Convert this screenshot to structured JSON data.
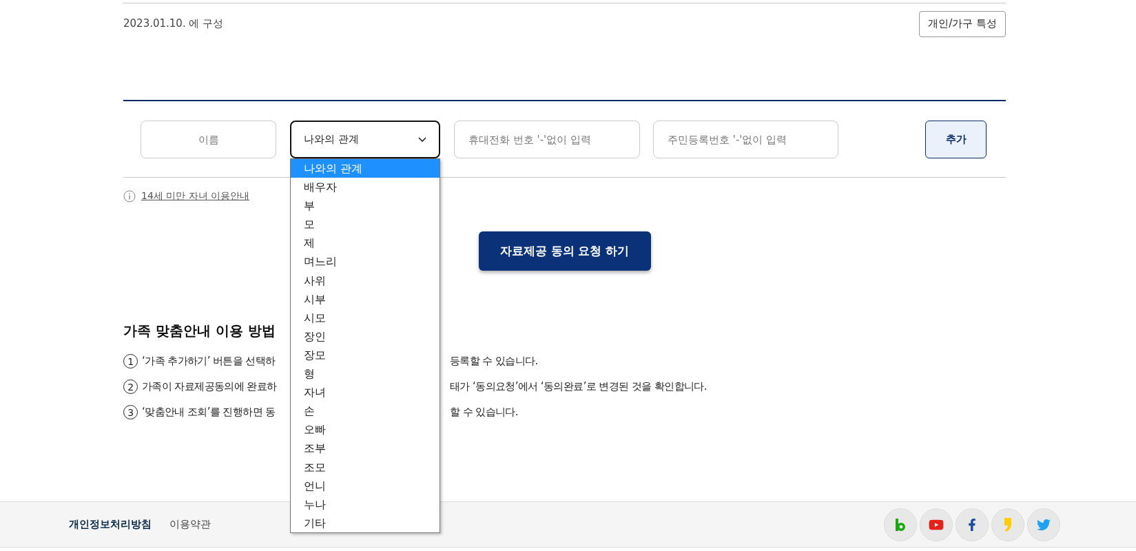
{
  "header": {
    "date": "2023.01.10. 에 구성",
    "profile_button": "개인/가구 특성"
  },
  "form": {
    "name_field": {
      "placeholder": "이름"
    },
    "relation_select": {
      "value": "나와의 관계",
      "expanded": true,
      "options": [
        {
          "label": "나와의 관계",
          "selected": true
        },
        {
          "label": "배우자",
          "selected": false
        },
        {
          "label": "부",
          "selected": false
        },
        {
          "label": "모",
          "selected": false
        },
        {
          "label": "제",
          "selected": false
        },
        {
          "label": "며느리",
          "selected": false
        },
        {
          "label": "사위",
          "selected": false
        },
        {
          "label": "시부",
          "selected": false
        },
        {
          "label": "시모",
          "selected": false
        },
        {
          "label": "장인",
          "selected": false
        },
        {
          "label": "장모",
          "selected": false
        },
        {
          "label": "형",
          "selected": false
        },
        {
          "label": "자녀",
          "selected": false
        },
        {
          "label": "손",
          "selected": false
        },
        {
          "label": "오빠",
          "selected": false
        },
        {
          "label": "조부",
          "selected": false
        },
        {
          "label": "조모",
          "selected": false
        },
        {
          "label": "언니",
          "selected": false
        },
        {
          "label": "누나",
          "selected": false
        },
        {
          "label": "기타",
          "selected": false
        }
      ]
    },
    "phone_field": {
      "placeholder": "휴대전화 번호 '-'없이 입력"
    },
    "id_field": {
      "placeholder": "주민등록번호 '-'없이 입력"
    },
    "add_button": "추가"
  },
  "info_link": "14세 미만 자녀 이용안내",
  "consent_button": "자료제공 동의 요청 하기",
  "guide": {
    "title": "가족 맞춤안내 이용 방법",
    "steps": [
      {
        "marker": "1",
        "text_before": "‘가족 추가하기’ 버튼을 선택하",
        "text_after": "등록할 수 있습니다."
      },
      {
        "marker": "2",
        "text_before": "가족이 자료제공동의에 완료하",
        "text_after": "태가 ‘동의요청’에서 ‘동의완료’로 변경된 것을 확인합니다."
      },
      {
        "marker": "3",
        "text_before": "‘맞춤안내 조회’를 진행하면 동",
        "text_after": "할 수 있습니다."
      }
    ]
  },
  "footer": {
    "links": [
      {
        "label": "개인정보처리방침",
        "kind": "strong"
      },
      {
        "label": "이용약관",
        "kind": "plain"
      }
    ],
    "social": [
      {
        "kind": "blog"
      },
      {
        "kind": "youtube"
      },
      {
        "kind": "facebook"
      },
      {
        "kind": "story"
      },
      {
        "kind": "twitter"
      }
    ]
  }
}
